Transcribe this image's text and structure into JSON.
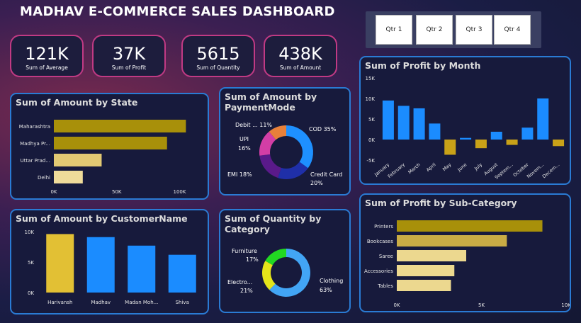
{
  "title": "MADHAV E-COMMERCE SALES DASHBOARD",
  "slicer": {
    "items": [
      "Qtr 1",
      "Qtr 2",
      "Qtr 3",
      "Qtr 4"
    ]
  },
  "kpis": [
    {
      "value": "121K",
      "label": "Sum of Average"
    },
    {
      "value": "37K",
      "label": "Sum of Profit"
    },
    {
      "value": "5615",
      "label": "Sum of Quantity"
    },
    {
      "value": "438K",
      "label": "Sum of Amount"
    }
  ],
  "colors": {
    "gold": "#a8900a",
    "goldLight": "#e8d27a",
    "blue": "#1b8cff",
    "accent": "#c13a84",
    "cardBorder": "#2a7bd4"
  },
  "chart_data": [
    {
      "id": "amount_by_state",
      "type": "bar",
      "orientation": "horizontal",
      "title": "Sum of Amount by State",
      "categories": [
        "Maharashtra",
        "Madhya Pr...",
        "Uttar Prad...",
        "Delhi"
      ],
      "values": [
        105000,
        90000,
        38000,
        23000
      ],
      "xlim": [
        0,
        120000
      ],
      "xticks": [
        "0K",
        "50K",
        "100K"
      ],
      "xtick_values": [
        0,
        50000,
        100000
      ],
      "colors": [
        "#a8900a",
        "#a8900a",
        "#e2c973",
        "#efdb9a"
      ]
    },
    {
      "id": "amount_by_paymentmode",
      "type": "pie",
      "donut": true,
      "title": "Sum of Amount by PaymentMode",
      "slices": [
        {
          "label": "COD",
          "pct": "35%",
          "value": 35,
          "color": "#1e90ff"
        },
        {
          "label": "Credit Card",
          "pct": "20%",
          "value": 20,
          "color": "#1f2fa8"
        },
        {
          "label": "EMI",
          "pct": "18%",
          "value": 18,
          "color": "#5a1a8a"
        },
        {
          "label": "UPI",
          "pct": "16%",
          "value": 16,
          "color": "#d33ea6"
        },
        {
          "label": "Debit ...",
          "pct": "11%",
          "value": 11,
          "color": "#e8803a"
        }
      ]
    },
    {
      "id": "profit_by_month",
      "type": "bar",
      "title": "Sum of Profit by Month",
      "categories": [
        "January",
        "February",
        "March",
        "April",
        "May",
        "June",
        "July",
        "August",
        "Septem...",
        "October",
        "Novem...",
        "Decem..."
      ],
      "values": [
        9500,
        8200,
        7600,
        3900,
        -3700,
        400,
        -2100,
        1900,
        -1300,
        2900,
        10000,
        -1600
      ],
      "ylim": [
        -5000,
        15000
      ],
      "yticks": [
        "15K",
        "10K",
        "5K",
        "0K",
        "-5K"
      ],
      "ytick_values": [
        15000,
        10000,
        5000,
        0,
        -5000
      ],
      "pos_color": "#1b8cff",
      "neg_color": "#c9a218"
    },
    {
      "id": "amount_by_customer",
      "type": "bar",
      "title": "Sum of Amount by CustomerName",
      "categories": [
        "Harivansh",
        "Madhav",
        "Madan Moh...",
        "Shiva"
      ],
      "values": [
        9600,
        9100,
        7700,
        6200
      ],
      "ylim": [
        0,
        10000
      ],
      "yticks": [
        "10K",
        "5K",
        "0K"
      ],
      "ytick_values": [
        10000,
        5000,
        0
      ],
      "colors": [
        "#e2c034",
        "#1b8cff",
        "#1b8cff",
        "#1b8cff"
      ]
    },
    {
      "id": "quantity_by_category",
      "type": "pie",
      "donut": true,
      "title": "Sum of Quantity by Category",
      "slices": [
        {
          "label": "Clothing",
          "pct": "63%",
          "value": 63,
          "color": "#42a5f5"
        },
        {
          "label": "Electro...",
          "pct": "21%",
          "value": 21,
          "color": "#e5e51a"
        },
        {
          "label": "Furniture",
          "pct": "17%",
          "value": 17,
          "color": "#22d822"
        }
      ]
    },
    {
      "id": "profit_by_subcategory",
      "type": "bar",
      "orientation": "horizontal",
      "title": "Sum of Profit by Sub-Category",
      "categories": [
        "Printers",
        "Bookcases",
        "Saree",
        "Accessories",
        "Tables"
      ],
      "values": [
        8600,
        6500,
        4100,
        3400,
        3200
      ],
      "xlim": [
        0,
        10000
      ],
      "xticks": [
        "0K",
        "5K",
        "10K"
      ],
      "xtick_values": [
        0,
        5000,
        10000
      ],
      "colors": [
        "#a8900a",
        "#c9ac45",
        "#ecd88f",
        "#ecd88f",
        "#ecd88f"
      ]
    }
  ]
}
